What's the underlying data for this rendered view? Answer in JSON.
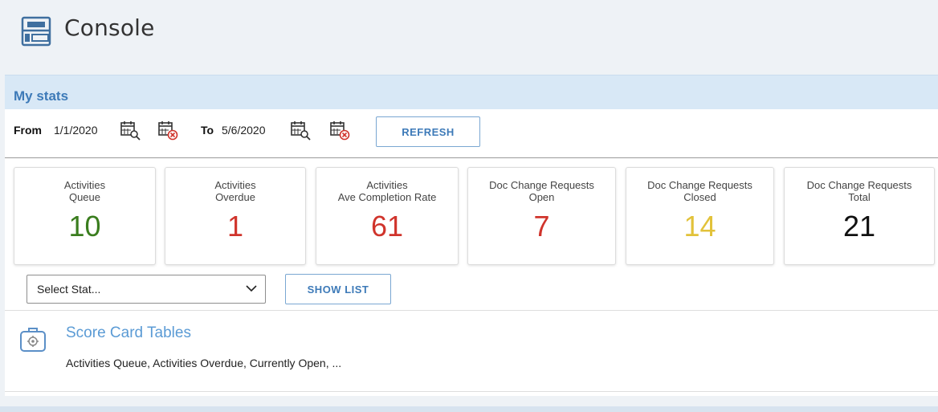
{
  "header": {
    "title": "Console",
    "icon": "console-icon"
  },
  "panel": {
    "title": "My stats",
    "from_label": "From",
    "from_date": "1/1/2020",
    "to_label": "To",
    "to_date": "5/6/2020",
    "refresh_label": "REFRESH"
  },
  "cards": [
    {
      "line1": "Activities",
      "line2": "Queue",
      "value": "10",
      "color": "#3a7d1e"
    },
    {
      "line1": "Activities",
      "line2": "Overdue",
      "value": "1",
      "color": "#d0342c"
    },
    {
      "line1": "Activities",
      "line2": "Ave Completion Rate",
      "value": "61",
      "color": "#d0342c"
    },
    {
      "line1": "Doc Change Requests",
      "line2": "Open",
      "value": "7",
      "color": "#d0342c"
    },
    {
      "line1": "Doc Change Requests",
      "line2": "Closed",
      "value": "14",
      "color": "#e2c23a"
    },
    {
      "line1": "Doc Change Requests",
      "line2": "Total",
      "value": "21",
      "color": "#111111"
    }
  ],
  "select": {
    "value": "Select Stat..."
  },
  "show_list_label": "SHOW LIST",
  "scorecard": {
    "title": "Score Card Tables",
    "description": "Activities Queue, Activities Overdue, Currently Open, ..."
  }
}
